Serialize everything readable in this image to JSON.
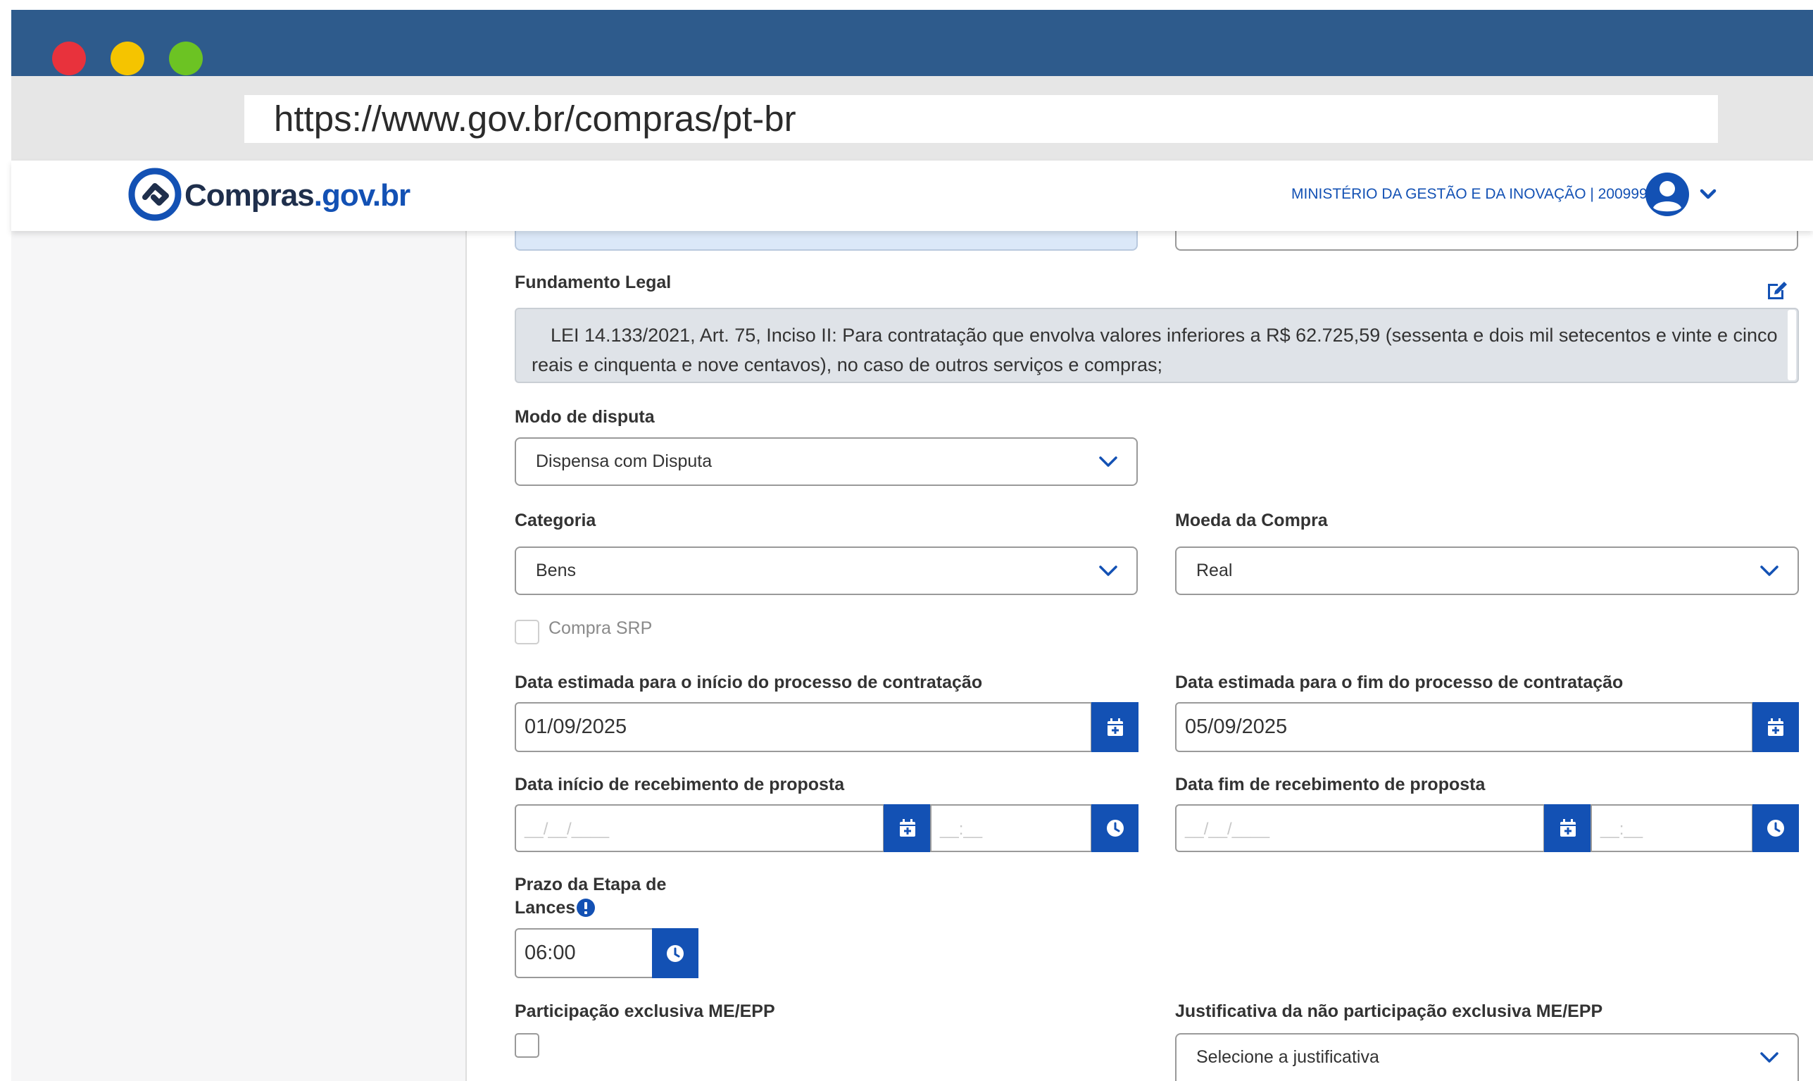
{
  "window": {
    "dots": [
      "#e8323c",
      "#f5c400",
      "#6cc323"
    ],
    "url": "https://www.gov.br/compras/pt-br"
  },
  "header": {
    "logo_main": "Compras",
    "logo_suffix": ".gov.br",
    "ministry": "MINISTÉRIO DA GESTÃO E DA INOVAÇÃO | 200999",
    "user_icon": "user-circle-icon",
    "menu_icon": "chevron-down-icon"
  },
  "form": {
    "fundamento_label": "Fundamento Legal",
    "fundamento_text": "LEI 14.133/2021, Art. 75, Inciso II: Para contratação que envolva valores inferiores a R$ 62.725,59 (sessenta e dois mil setecentos e vinte e cinco reais e cinquenta e nove centavos), no caso de outros serviços e compras;",
    "modo_label": "Modo de disputa",
    "modo_value": "Dispensa com Disputa",
    "categoria_label": "Categoria",
    "categoria_value": "Bens",
    "moeda_label": "Moeda da Compra",
    "moeda_value": "Real",
    "srp_label": "Compra SRP",
    "data_inicio_label": "Data estimada para o início do processo de contratação",
    "data_inicio_value": "01/09/2025",
    "data_fim_label": "Data estimada para o fim do processo de contratação",
    "data_fim_value": "05/09/2025",
    "receb_inicio_label": "Data início de recebimento de proposta",
    "receb_fim_label": "Data fim de recebimento de proposta",
    "date_placeholder": "__/__/____",
    "time_placeholder": "__:__",
    "prazo_label_1": "Prazo da Etapa de",
    "prazo_label_2": "Lances",
    "prazo_value": "06:00",
    "me_epp_label": "Participação exclusiva ME/EPP",
    "justificativa_label": "Justificativa da não participação exclusiva ME/EPP",
    "justificativa_value": "Selecione a justificativa"
  },
  "colors": {
    "titlebar": "#2e5b8c",
    "primary": "#1351b4",
    "readonly_bg": "#dfe3e8"
  }
}
